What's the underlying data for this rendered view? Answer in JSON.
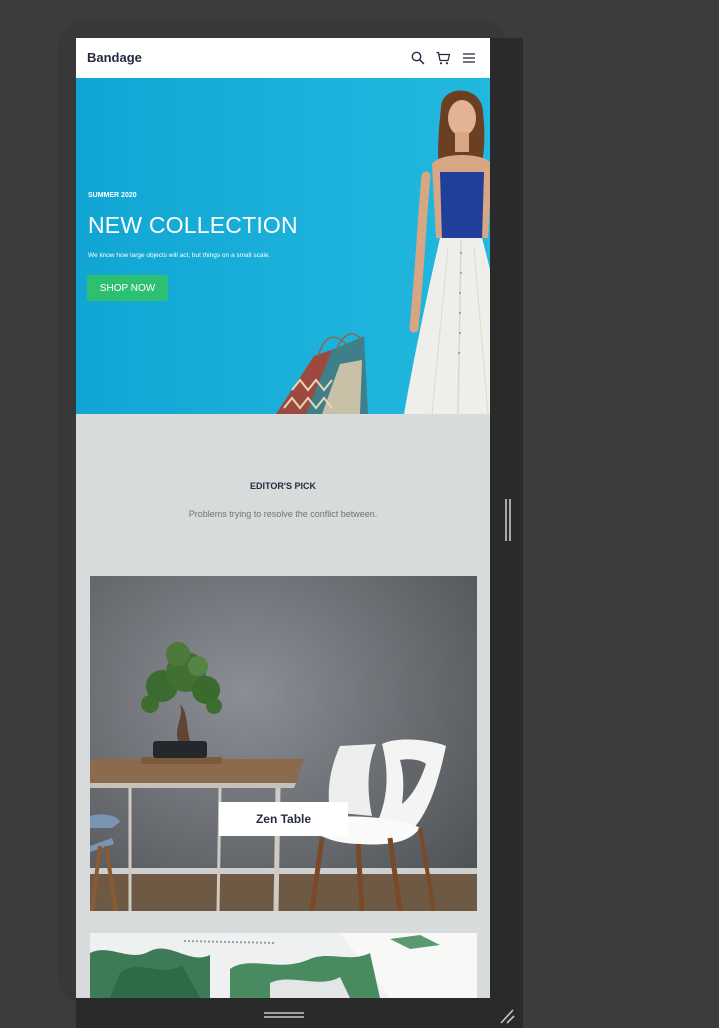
{
  "header": {
    "brand": "Bandage",
    "icons": [
      "search-icon",
      "cart-icon",
      "menu-icon"
    ]
  },
  "hero": {
    "kicker": "SUMMER 2020",
    "title": "NEW COLLECTION",
    "description": "We know how large objects will act, but things on a small scale.",
    "cta": "SHOP NOW"
  },
  "editors_pick": {
    "title": "EDITOR'S PICK",
    "subtitle": "Problems trying to resolve the conflict between."
  },
  "products": [
    {
      "label": "Zen Table"
    }
  ],
  "colors": {
    "hero_bg": "#1cb2db",
    "cta_green": "#2dc071",
    "section_bg": "#d7dbdb",
    "dark_text": "#252b42",
    "muted_text": "#737373"
  }
}
